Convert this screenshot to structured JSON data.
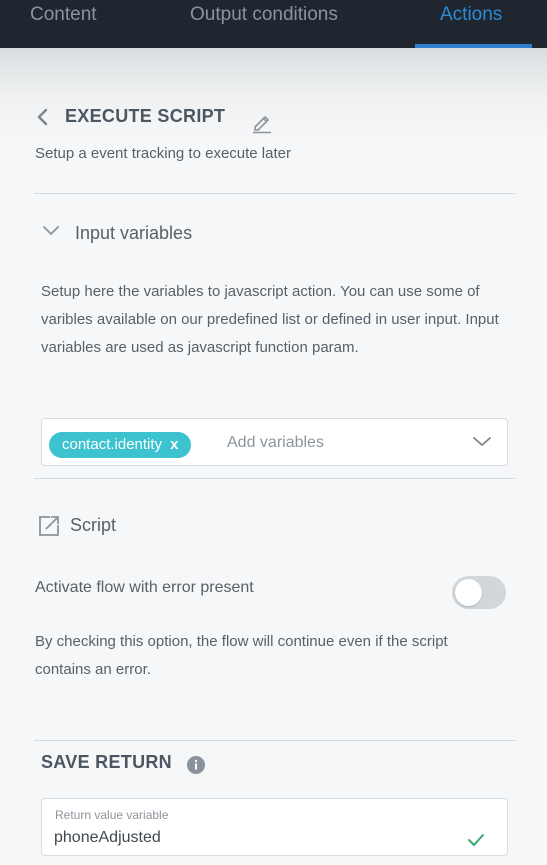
{
  "tabs": [
    {
      "label": "Content"
    },
    {
      "label": "Output conditions"
    },
    {
      "label": "Actions",
      "active": true
    }
  ],
  "header": {
    "back_icon": "chevron-left-icon",
    "title": "EXECUTE SCRIPT",
    "edit_icon": "pencil-icon",
    "subtitle": "Setup a event tracking to execute later"
  },
  "input_variables": {
    "title": "Input variables",
    "expanded": true,
    "description": "Setup here the variables to javascript action. You can use some of varibles available on our predefined list or defined in user input. Input variables are used as javascript function param.",
    "selected": [
      {
        "label": "contact.identity",
        "remove": "x"
      }
    ],
    "placeholder": "Add variables"
  },
  "script": {
    "icon": "external-edit-icon",
    "title": "Script"
  },
  "error_flow": {
    "label": "Activate flow with error present",
    "enabled": false,
    "description": "By checking this option, the flow will continue even if the script contains an error."
  },
  "save_return": {
    "title": "SAVE RETURN",
    "info_icon": "info-icon",
    "field_label": "Return value variable",
    "value": "phoneAdjusted",
    "valid": true
  },
  "colors": {
    "topbar": "#1f2630",
    "active_tab": "#2d8bd6",
    "chip": "#3cc3cf",
    "check": "#3aa76d",
    "toggle_off": "#d2d7dc"
  }
}
